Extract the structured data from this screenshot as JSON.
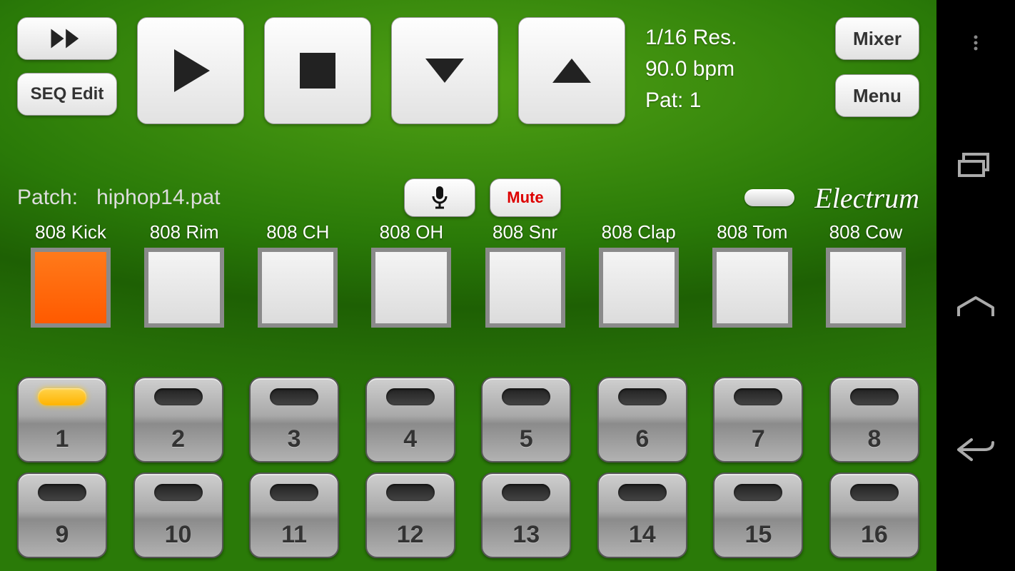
{
  "transport": {
    "seq_edit_label": "SEQ Edit"
  },
  "status": {
    "resolution": "1/16 Res.",
    "bpm": "90.0 bpm",
    "pattern": "Pat: 1"
  },
  "side": {
    "mixer_label": "Mixer",
    "menu_label": "Menu"
  },
  "patch": {
    "label": "Patch:",
    "file": "hiphop14.pat",
    "mute_label": "Mute"
  },
  "brand": "Electrum",
  "pads": [
    {
      "label": "808 Kick",
      "active": true
    },
    {
      "label": "808 Rim",
      "active": false
    },
    {
      "label": "808 CH",
      "active": false
    },
    {
      "label": "808 OH",
      "active": false
    },
    {
      "label": "808 Snr",
      "active": false
    },
    {
      "label": "808 Clap",
      "active": false
    },
    {
      "label": "808 Tom",
      "active": false
    },
    {
      "label": "808 Cow",
      "active": false
    }
  ],
  "steps": [
    {
      "n": "1",
      "on": true
    },
    {
      "n": "2",
      "on": false
    },
    {
      "n": "3",
      "on": false
    },
    {
      "n": "4",
      "on": false
    },
    {
      "n": "5",
      "on": false
    },
    {
      "n": "6",
      "on": false
    },
    {
      "n": "7",
      "on": false
    },
    {
      "n": "8",
      "on": false
    },
    {
      "n": "9",
      "on": false
    },
    {
      "n": "10",
      "on": false
    },
    {
      "n": "11",
      "on": false
    },
    {
      "n": "12",
      "on": false
    },
    {
      "n": "13",
      "on": false
    },
    {
      "n": "14",
      "on": false
    },
    {
      "n": "15",
      "on": false
    },
    {
      "n": "16",
      "on": false
    }
  ]
}
